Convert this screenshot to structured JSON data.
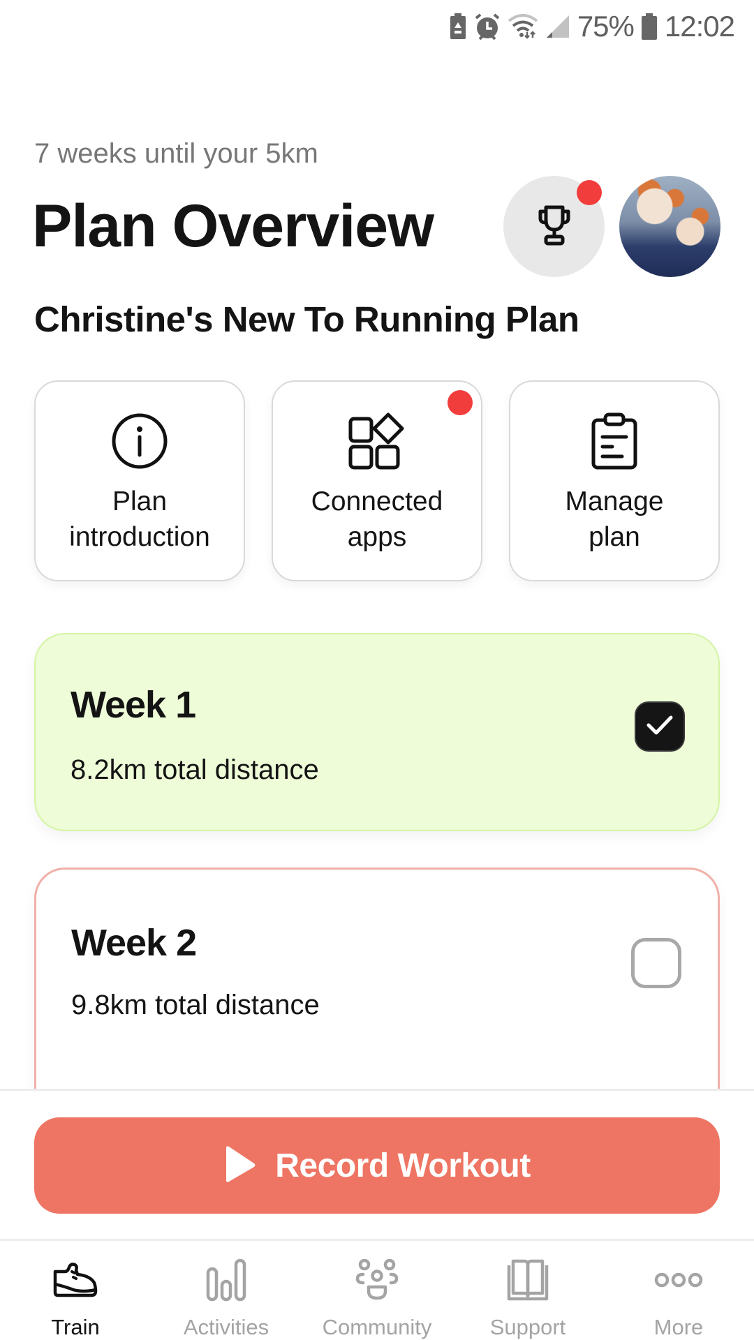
{
  "status_bar": {
    "icons": [
      "battery-saver-icon",
      "alarm-icon",
      "wifi-icon",
      "signal-icon",
      "battery-icon"
    ],
    "battery_percent": "75%",
    "time": "12:02"
  },
  "header": {
    "subtitle": "7 weeks until your 5km",
    "title": "Plan Overview",
    "trophy_has_notification": true,
    "avatar_alt": "User avatar"
  },
  "plan": {
    "name": "Christine's New To Running Plan"
  },
  "tiles": [
    {
      "label": "Plan\nintroduction",
      "icon": "info-icon",
      "has_notification": false
    },
    {
      "label": "Connected\napps",
      "icon": "apps-icon",
      "has_notification": true
    },
    {
      "label": "Manage\nplan",
      "icon": "clipboard-icon",
      "has_notification": false
    }
  ],
  "weeks": [
    {
      "title": "Week 1",
      "distance": "8.2km total distance",
      "completed": true
    },
    {
      "title": "Week 2",
      "distance": "9.8km total distance",
      "completed": false
    }
  ],
  "actions": {
    "record_label": "Record Workout"
  },
  "nav": {
    "items": [
      {
        "label": "Train",
        "icon": "shoe-icon",
        "active": true
      },
      {
        "label": "Activities",
        "icon": "bar-chart-icon",
        "active": false
      },
      {
        "label": "Community",
        "icon": "community-icon",
        "active": false
      },
      {
        "label": "Support",
        "icon": "book-icon",
        "active": false
      },
      {
        "label": "More",
        "icon": "more-icon",
        "active": false
      }
    ]
  },
  "colors": {
    "accent": "#ee7563",
    "notification": "#f23d3d",
    "completed_bg": "#eefcd8",
    "completed_border": "#d4f5a4",
    "pending_border": "#f0b0a8",
    "nav_inactive": "#a4a4a4"
  }
}
